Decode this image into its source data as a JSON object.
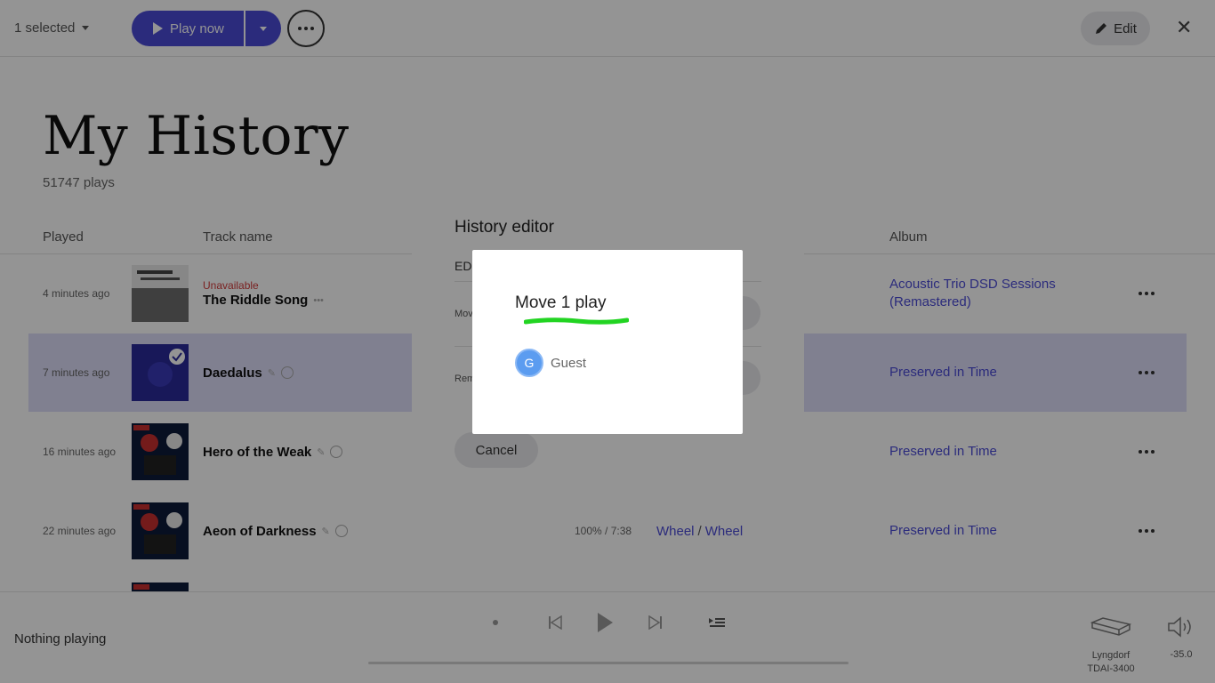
{
  "topbar": {
    "selection_label": "1 selected",
    "play_label": "Play now",
    "edit_label": "Edit"
  },
  "page": {
    "title": "My History",
    "plays_count": "51747 plays"
  },
  "table": {
    "headers": {
      "played": "Played",
      "track": "Track name",
      "album": "Album"
    },
    "rows": [
      {
        "played": "4 minutes ago",
        "status": "Unavailable",
        "title": "The Riddle Song",
        "album": "Acoustic Trio DSD Sessions (Remastered)",
        "selected": false
      },
      {
        "played": "7 minutes ago",
        "title": "Daedalus",
        "album": "Preserved in Time",
        "selected": true
      },
      {
        "played": "16 minutes ago",
        "title": "Hero of the Weak",
        "album": "Preserved in Time",
        "selected": false
      },
      {
        "played": "22 minutes ago",
        "title": "Aeon of Darkness",
        "duration": "100% / 7:38",
        "artist": "Wheel",
        "artist2": "Wheel",
        "album": "Preserved in Time",
        "selected": false
      }
    ]
  },
  "player": {
    "status": "Nothing playing",
    "zone_line1": "Lyngdorf",
    "zone_line2": "TDAI-3400",
    "volume": "-35.0"
  },
  "history_editor": {
    "title": "History editor",
    "partial_tab": "ED",
    "move_row_label": "Mov",
    "remove_row_label": "Rem",
    "cancel_label": "Cancel"
  },
  "move_dialog": {
    "title": "Move 1 play",
    "profile_initial": "G",
    "profile_name": "Guest",
    "highlight_color": "#22d422"
  }
}
